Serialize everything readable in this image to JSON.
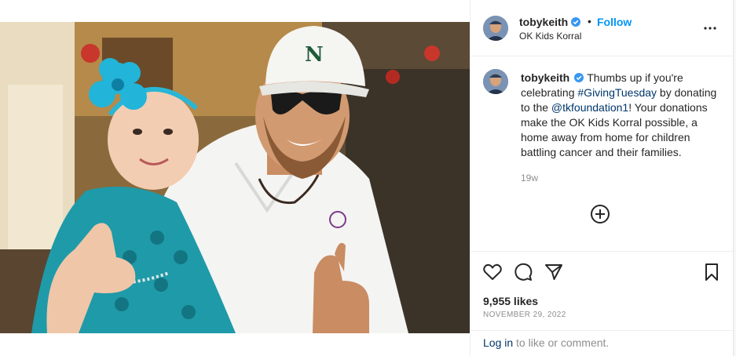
{
  "post": {
    "author": "tobykeith",
    "follow_label": "Follow",
    "separator": "•",
    "location": "OK Kids Korral",
    "caption_username": "tobykeith",
    "caption_part1": "Thumbs up if you're celebrating ",
    "hashtag": "#GivingTuesday",
    "caption_part2": " by donating to the ",
    "mention": "@tkfoundation1",
    "caption_part3": "! Your donations make the OK Kids Korral possible, a home away from home for children battling cancer and their families.",
    "time_ago": "19w",
    "likes": "9,955 likes",
    "date": "NOVEMBER 29, 2022",
    "login_link": "Log in",
    "login_rest": " to like or comment."
  },
  "icons": {
    "verified": "verified-badge-icon",
    "more": "more-options-icon",
    "add": "add-comment-plus-icon",
    "like": "heart-icon",
    "comment": "comment-bubble-icon",
    "share": "paper-plane-icon",
    "save": "bookmark-icon"
  },
  "colors": {
    "accent": "#0095f6",
    "link": "#00376b",
    "muted": "#8e8e8e",
    "verified": "#3897f0"
  }
}
